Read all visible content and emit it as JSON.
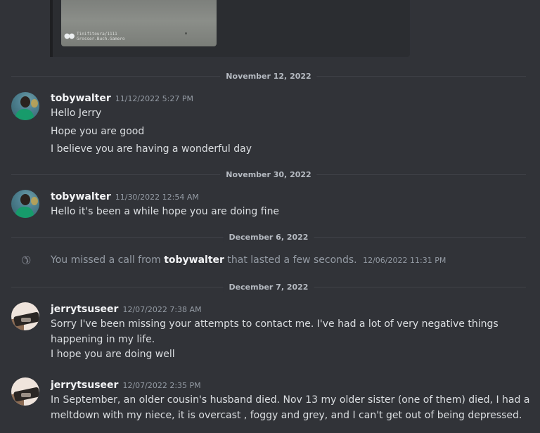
{
  "embed": {
    "media_caption_line1": "Tinifitoura/1111",
    "media_caption_line2": "Grosser.Buch.Gamero"
  },
  "dividers": {
    "d1": "November 12, 2022",
    "d2": "November 30, 2022",
    "d3": "December 6, 2022",
    "d4": "December 7, 2022"
  },
  "messages": [
    {
      "username": "tobywalter",
      "timestamp": "11/12/2022 5:27 PM",
      "lines": [
        "Hello Jerry",
        "Hope you are good",
        "I believe you are having a wonderful day"
      ]
    },
    {
      "username": "tobywalter",
      "timestamp": "11/30/2022 12:54 AM",
      "lines": [
        "Hello it's been a while hope you are doing fine"
      ]
    },
    {
      "username": "jerrytsuseer",
      "timestamp": "12/07/2022 7:38 AM",
      "lines": [
        "Sorry I've been missing your attempts to contact me. I've had a lot of very negative things",
        "happening in my life.",
        "I hope you are doing well"
      ]
    },
    {
      "username": "jerrytsuseer",
      "timestamp": "12/07/2022 2:35 PM",
      "lines": [
        "In September, an older cousin's husband died. Nov 13 my older sister (one of them) died, I had a",
        "meltdown with my niece, it is overcast , foggy and grey, and I can't get out of being depressed."
      ]
    }
  ],
  "missed_call": {
    "prefix": "You missed a call from",
    "caller": "tobywalter",
    "suffix": "that lasted a few seconds.",
    "timestamp": "12/06/2022 11:31 PM",
    "icon": "phone-icon"
  },
  "colors": {
    "background": "#313338",
    "username": "#f2f3f5",
    "muted": "#949ba4"
  }
}
